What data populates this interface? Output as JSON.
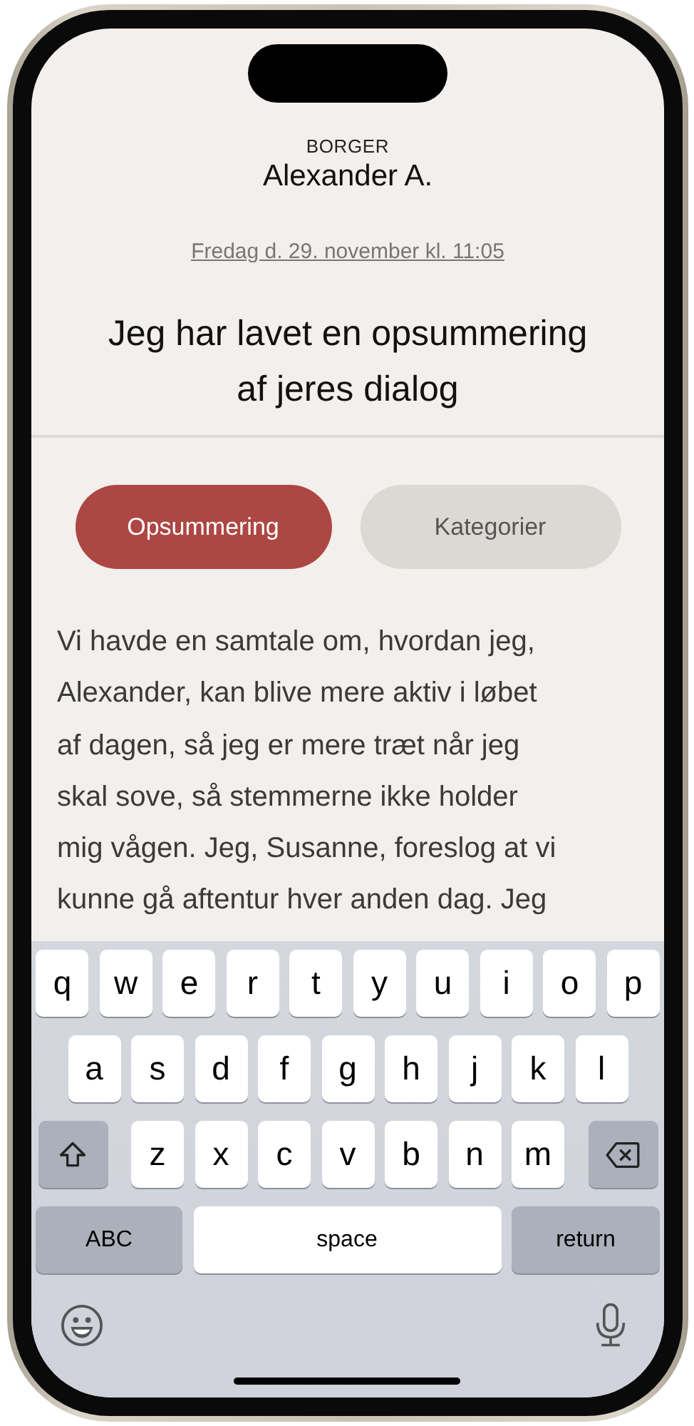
{
  "header": {
    "role": "BORGER",
    "name": "Alexander A.",
    "date": "Fredag d. 29. november kl. 11:05"
  },
  "title": "Jeg har lavet en opsummering af jeres dialog",
  "tabs": [
    {
      "label": "Opsummering",
      "selected": true
    },
    {
      "label": "Kategorier",
      "selected": false
    }
  ],
  "summary_lines": [
    "Vi havde en samtale om, hvordan jeg,",
    "Alexander, kan blive mere aktiv i løbet",
    "af dagen, så jeg er mere træt når jeg",
    "skal sove, så stemmerne ikke holder",
    "mig vågen. Jeg, Susanne, foreslog at vi",
    "kunne gå aftentur hver anden dag. Jeg"
  ],
  "keyboard": {
    "letter_rows": [
      [
        "q",
        "w",
        "e",
        "r",
        "t",
        "y",
        "u",
        "i",
        "o",
        "p"
      ],
      [
        "a",
        "s",
        "d",
        "f",
        "g",
        "h",
        "j",
        "k",
        "l"
      ],
      [
        "z",
        "x",
        "c",
        "v",
        "b",
        "n",
        "m"
      ]
    ],
    "mode_key": "ABC",
    "space_key": "space",
    "return_key": "return"
  }
}
